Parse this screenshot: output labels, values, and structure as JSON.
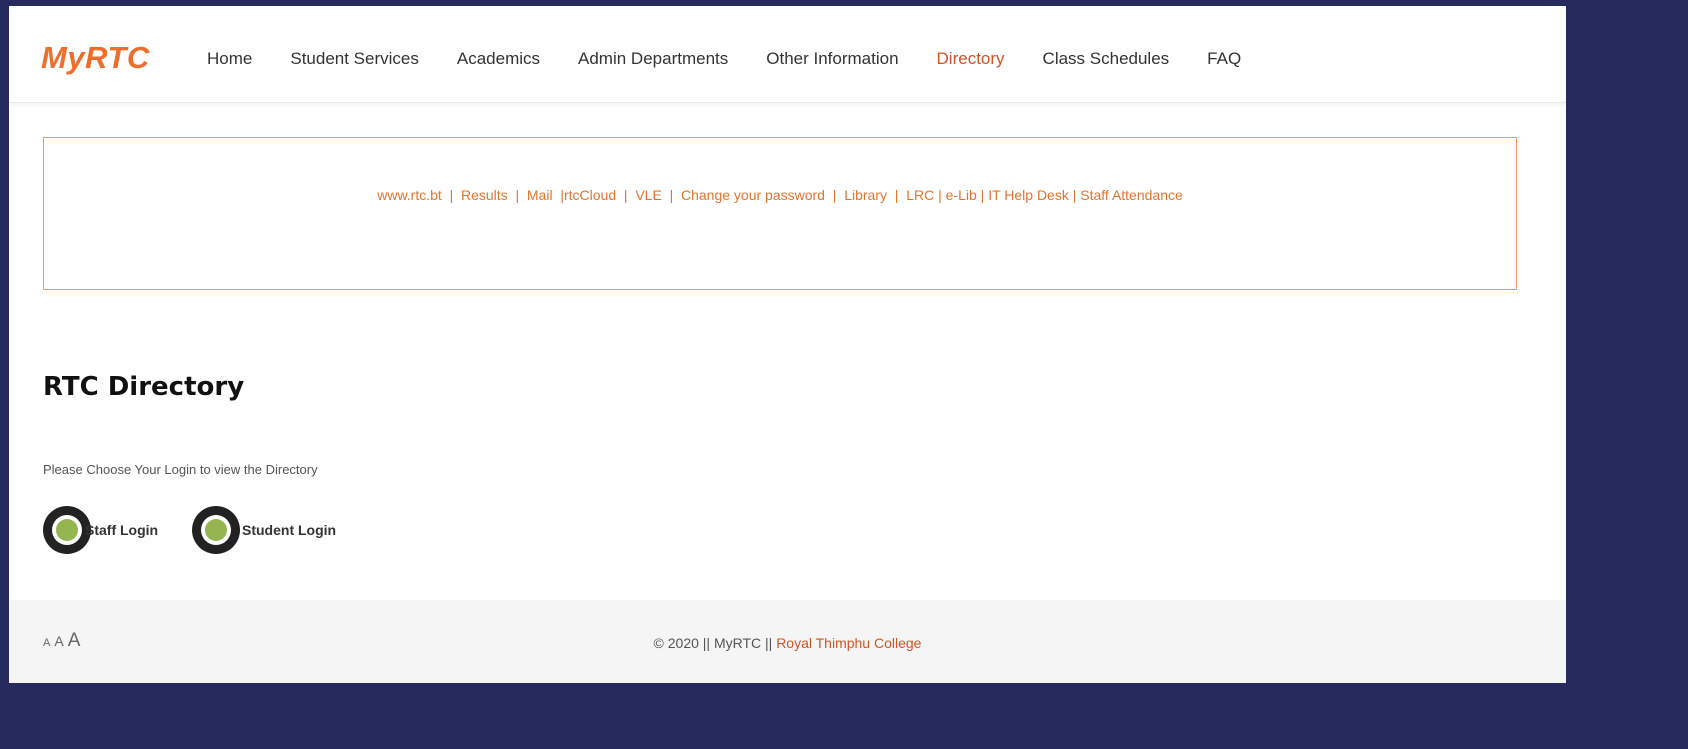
{
  "header": {
    "logo": "MyRTC",
    "nav": [
      {
        "label": "Home",
        "active": false
      },
      {
        "label": "Student Services",
        "active": false
      },
      {
        "label": "Academics",
        "active": false
      },
      {
        "label": "Admin Departments",
        "active": false
      },
      {
        "label": "Other Information",
        "active": false
      },
      {
        "label": "Directory",
        "active": true
      },
      {
        "label": "Class Schedules",
        "active": false
      },
      {
        "label": "FAQ",
        "active": false
      }
    ]
  },
  "quicklinks": [
    "www.rtc.bt",
    "Results",
    "Mail",
    "rtcCloud",
    "VLE",
    "Change your password",
    "Library",
    "LRC",
    "e-Lib",
    "IT Help Desk",
    "Staff Attendance"
  ],
  "main": {
    "title": "RTC Directory",
    "intro": "Please Choose Your Login to view the Directory",
    "staff_login": "Staff Login",
    "student_login": "Student Login"
  },
  "footer": {
    "font_sizes": [
      "A",
      "A",
      "A"
    ],
    "copyright_prefix": "© 2020 || MyRTC || ",
    "college_link": "Royal Thimphu College"
  },
  "colors": {
    "accent": "#ee6f2d",
    "active_nav": "#cf5428",
    "frame_background": "#272a5c",
    "login_dot": "#95b550"
  }
}
